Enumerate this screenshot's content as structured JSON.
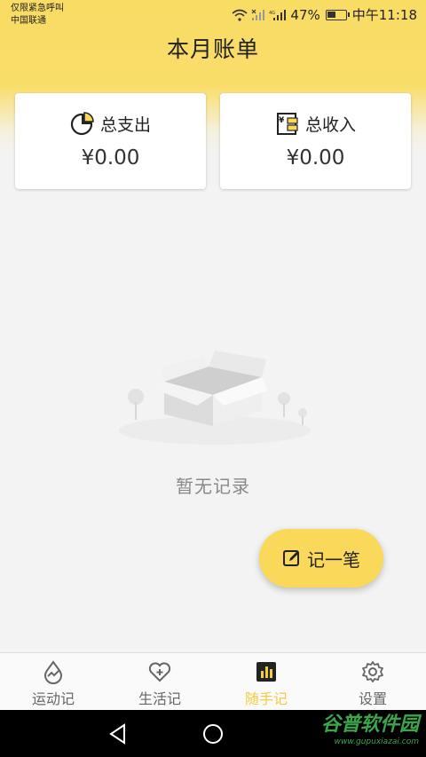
{
  "status_bar": {
    "line1": "仅限紧急呼叫",
    "line2": "中国联通",
    "battery": "47%",
    "time": "中午11:18"
  },
  "header": {
    "title": "本月账单"
  },
  "summary": {
    "expense": {
      "label": "总支出",
      "amount": "¥0.00",
      "icon": "pie-chart-icon"
    },
    "income": {
      "label": "总收入",
      "amount": "¥0.00",
      "icon": "ledger-icon"
    }
  },
  "empty_state": {
    "text": "暂无记录",
    "icon": "empty-box-illustration"
  },
  "fab": {
    "label": "记一笔",
    "icon": "edit-icon"
  },
  "bottom_nav": {
    "items": [
      {
        "label": "运动记",
        "icon": "drop-pulse-icon",
        "active": false
      },
      {
        "label": "生活记",
        "icon": "heart-plus-icon",
        "active": false
      },
      {
        "label": "随手记",
        "icon": "bar-chart-icon",
        "active": true
      },
      {
        "label": "设置",
        "icon": "gear-icon",
        "active": false
      }
    ]
  },
  "watermark": {
    "main": "谷普软件园",
    "sub": "www.gupuxiazai.com"
  },
  "colors": {
    "accent": "#f9d85a",
    "active_nav": "#f1cc3e"
  }
}
